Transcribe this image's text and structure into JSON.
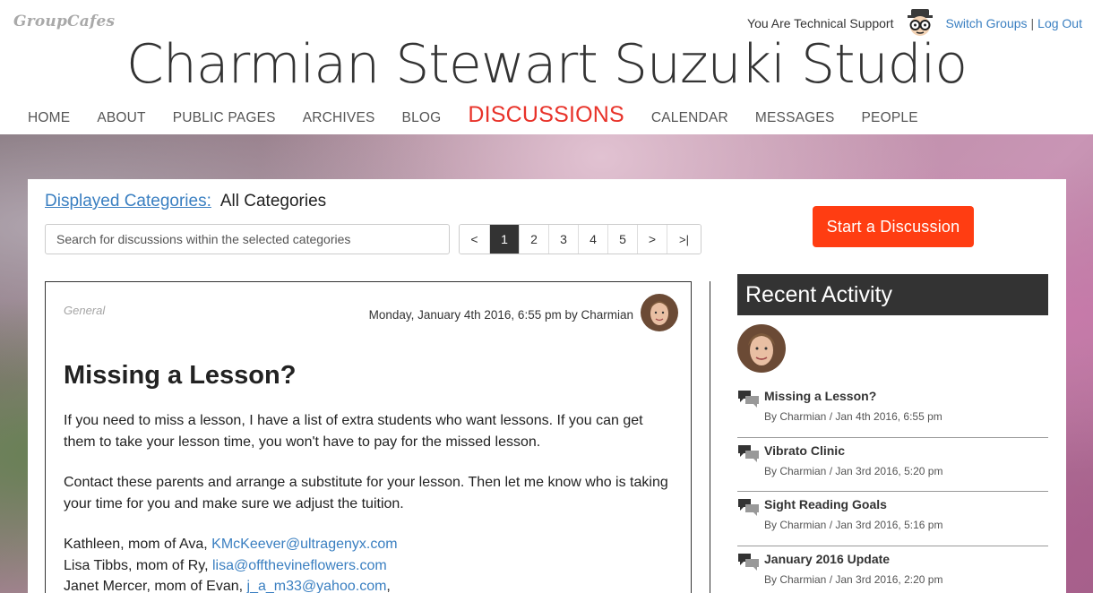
{
  "brand": {
    "logo": "GroupCafes"
  },
  "user_bar": {
    "role_text": "You Are Technical Support",
    "switch_groups": "Switch Groups",
    "separator": "|",
    "log_out": "Log Out"
  },
  "site": {
    "title": "Charmian Stewart Suzuki Studio"
  },
  "nav": {
    "items": [
      "HOME",
      "ABOUT",
      "PUBLIC PAGES",
      "ARCHIVES",
      "BLOG",
      "DISCUSSIONS",
      "CALENDAR",
      "MESSAGES",
      "PEOPLE"
    ],
    "active": "DISCUSSIONS"
  },
  "filters": {
    "categories_label": "Displayed Categories:",
    "categories_value": "All Categories",
    "search_placeholder": "Search for discussions within the selected categories"
  },
  "pagination": {
    "prev": "<",
    "pages": [
      "1",
      "2",
      "3",
      "4",
      "5"
    ],
    "active_page": "1",
    "next": ">",
    "last": ">|"
  },
  "actions": {
    "start_discussion": "Start a Discussion"
  },
  "discussion": {
    "category": "General",
    "meta": "Monday, January 4th 2016, 6:55 pm by Charmian",
    "title": "Missing a Lesson?",
    "paragraphs": [
      "If you need to miss a lesson, I have a list of extra students who want lessons. If you can get them to take your lesson time, you won't have to pay for the missed lesson.",
      "Contact these parents and arrange a substitute for your lesson. Then let me know who is taking your time for you and make sure we adjust the tuition."
    ],
    "contacts": [
      {
        "name": "Kathleen, mom of Ava, ",
        "email": "KMcKeever@ultragenyx.com",
        "suffix": ""
      },
      {
        "name": "Lisa Tibbs, mom of Ry, ",
        "email": "lisa@offthevineflowers.com",
        "suffix": ""
      },
      {
        "name": "Janet Mercer, mom of Evan, ",
        "email": "j_a_m33@yahoo.com",
        "suffix": ","
      }
    ]
  },
  "recent_activity": {
    "heading": "Recent Activity",
    "items": [
      {
        "title": "Missing a Lesson?",
        "meta": "By Charmian / Jan 4th 2016, 6:55 pm"
      },
      {
        "title": "Vibrato Clinic",
        "meta": "By Charmian / Jan 3rd 2016, 5:20 pm"
      },
      {
        "title": "Sight Reading Goals",
        "meta": "By Charmian / Jan 3rd 2016, 5:16 pm"
      },
      {
        "title": "January 2016 Update",
        "meta": "By Charmian / Jan 3rd 2016, 2:20 pm"
      }
    ]
  },
  "colors": {
    "accent": "#e8332a",
    "cta": "#ff3d12",
    "link": "#3a7fc1",
    "dark": "#333333"
  },
  "icons": {
    "user_avatar": "nerd-avatar-icon",
    "author_avatar": "author-avatar",
    "activity": "chat-bubbles-icon"
  }
}
